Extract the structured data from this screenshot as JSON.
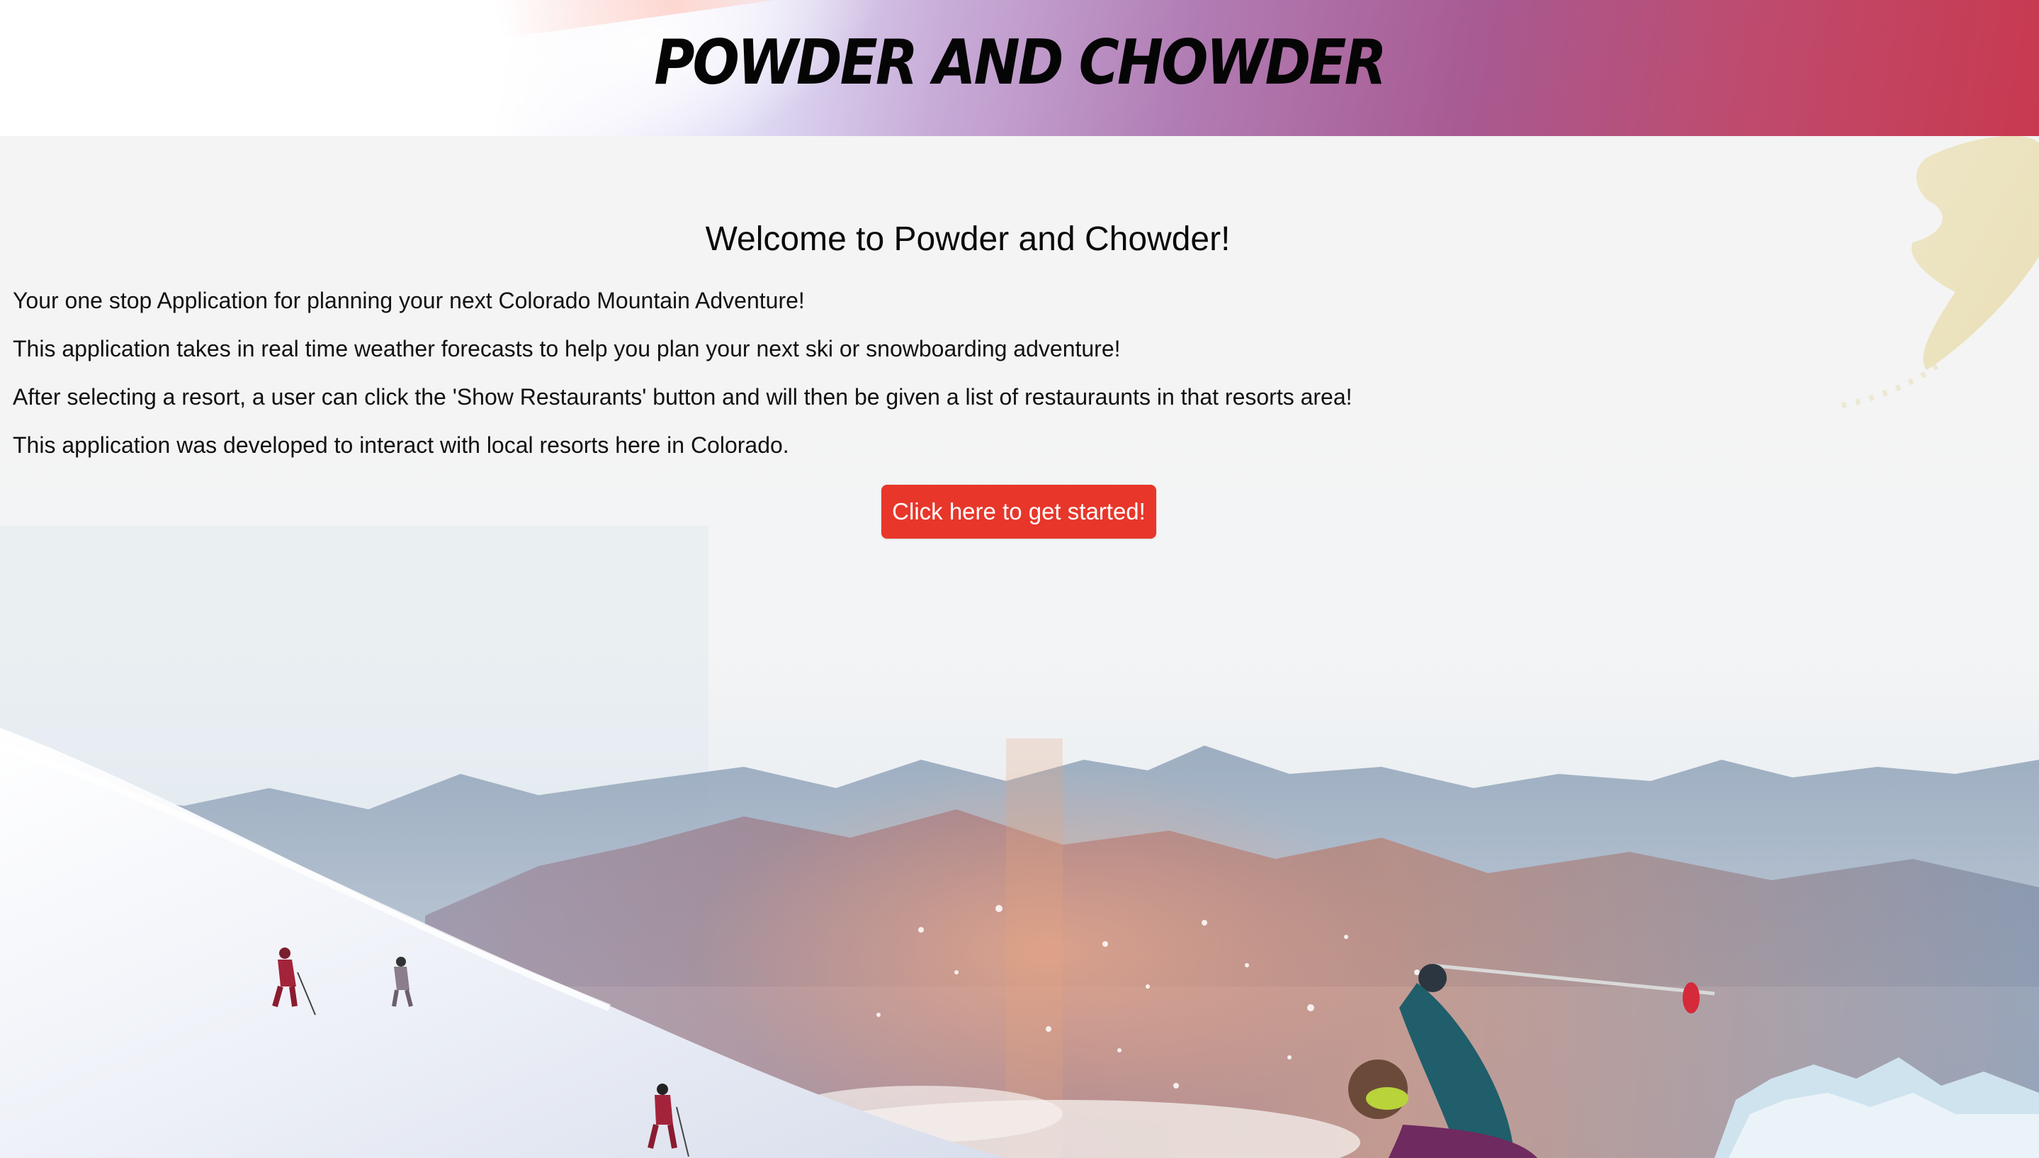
{
  "header": {
    "title": "Powder and Chowder"
  },
  "main": {
    "heading": "Welcome to Powder and Chowder!",
    "paragraphs": [
      "Your one stop Application for planning your next Colorado Mountain Adventure!",
      "This application takes in real time weather forecasts to help you plan your next ski or snowboarding adventure!",
      "After selecting a resort, a user can click the 'Show Restaurants' button and will then be given a list of restauraunts in that resorts area!",
      "This application was developed to interact with local resorts here in Colorado."
    ],
    "start_button_label": "Click here to get started!"
  },
  "colors": {
    "accent_button": "#e8362a",
    "header_gradient_end": "#c8394f",
    "background": "#f4f4f4"
  }
}
